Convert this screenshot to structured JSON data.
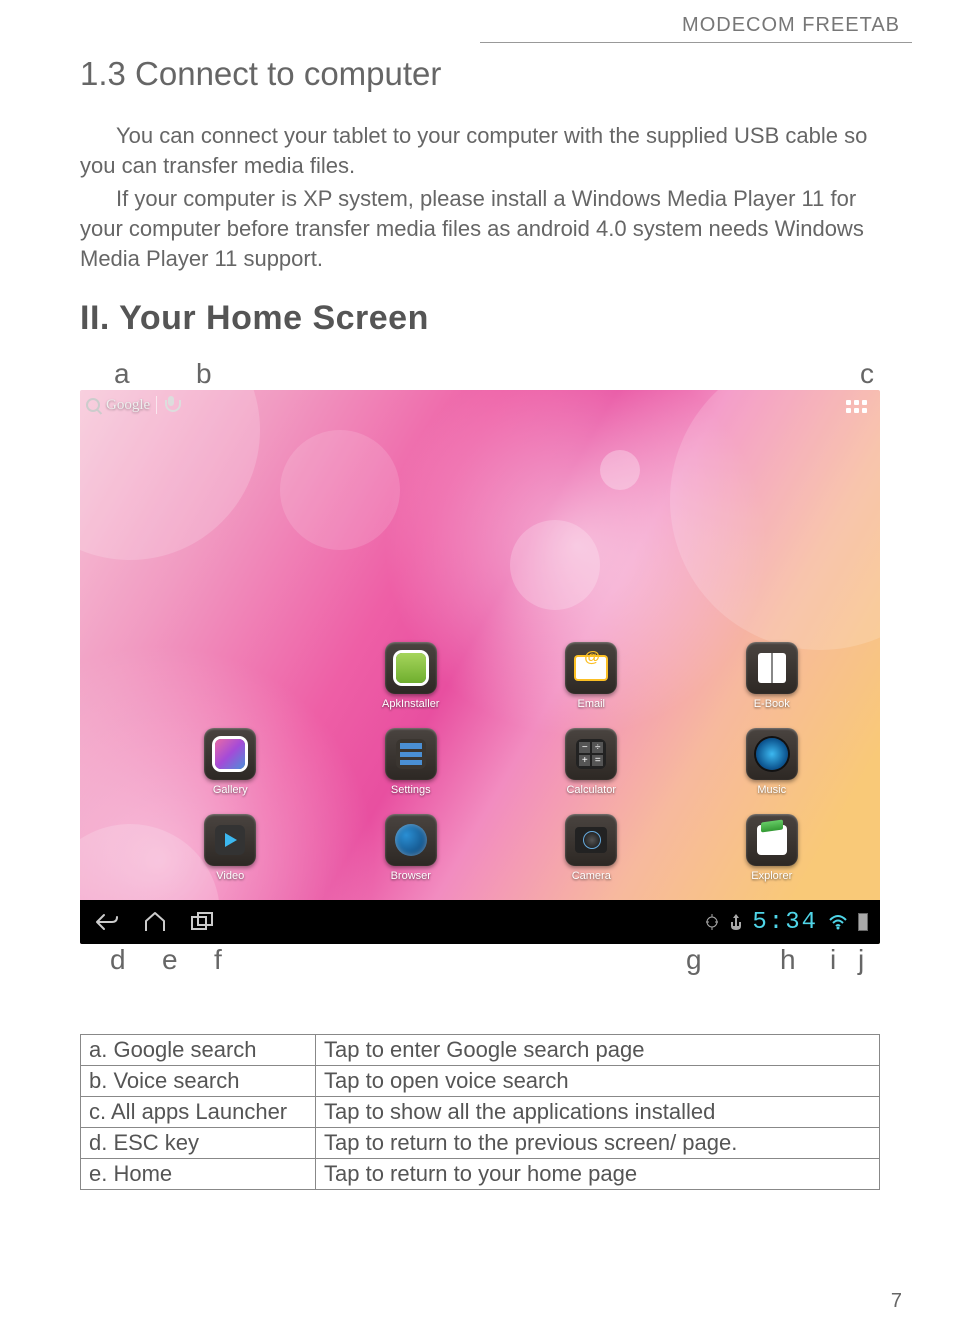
{
  "header_brand": "MODECOM FREETAB",
  "section_1_3_title": "1.3 Connect to computer",
  "para1": "You can connect your tablet to your computer with the supplied USB cable so you can transfer media files.",
  "para2": "If your computer is XP system, please install a Windows Media Player 11 for your computer before transfer media files as android 4.0 system needs Windows Media Player 11 support.",
  "section_II_title": "II. Your Home Screen",
  "callouts_top": {
    "a": "a",
    "b": "b",
    "c": "c"
  },
  "callouts_bottom": {
    "d": "d",
    "e": "e",
    "f": "f",
    "g": "g",
    "h": "h",
    "i": "i",
    "j": "j"
  },
  "screenshot": {
    "google_label": "Google",
    "apps": {
      "apkinstaller": "ApkInstaller",
      "email": "Email",
      "ebook": "E-Book",
      "gallery": "Gallery",
      "settings": "Settings",
      "calculator": "Calculator",
      "music": "Music",
      "video": "Video",
      "browser": "Browser",
      "camera": "Camera",
      "explorer": "Explorer"
    },
    "calc_keys": [
      "−",
      "÷",
      "+",
      "="
    ],
    "clock": "5:34"
  },
  "legend": [
    {
      "key": "a. Google search",
      "desc": "Tap to enter Google search page"
    },
    {
      "key": "b. Voice search",
      "desc": "Tap to open voice search"
    },
    {
      "key": "c. All apps Launcher",
      "desc": "Tap to show all the applications installed"
    },
    {
      "key": "d. ESC key",
      "desc": "Tap to return to the previous screen/ page."
    },
    {
      "key": "e. Home",
      "desc": "Tap to return to your home page"
    }
  ],
  "page_number": "7"
}
